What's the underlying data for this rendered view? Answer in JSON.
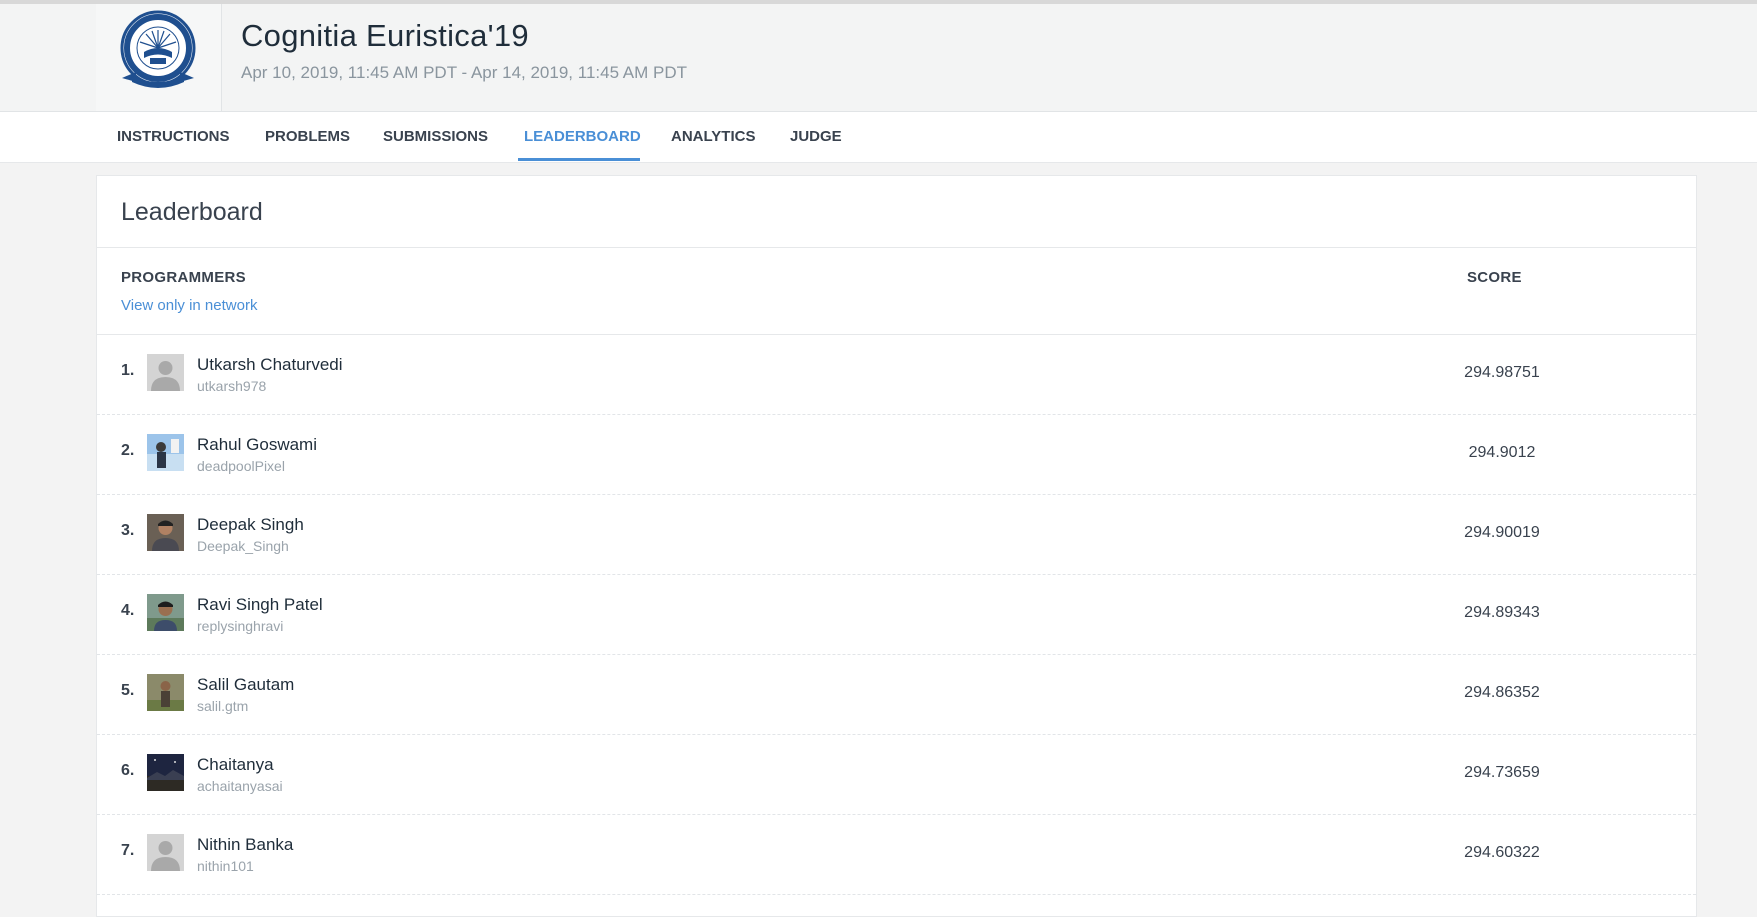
{
  "contest": {
    "title": "Cognitia Euristica'19",
    "dates": "Apr 10, 2019, 11:45 AM PDT - Apr 14, 2019, 11:45 AM PDT"
  },
  "tabs": [
    {
      "label": "INSTRUCTIONS",
      "active": false
    },
    {
      "label": "PROBLEMS",
      "active": false
    },
    {
      "label": "SUBMISSIONS",
      "active": false
    },
    {
      "label": "LEADERBOARD",
      "active": true
    },
    {
      "label": "ANALYTICS",
      "active": false
    },
    {
      "label": "JUDGE",
      "active": false
    }
  ],
  "leaderboard": {
    "title": "Leaderboard",
    "col_programmers": "PROGRAMMERS",
    "col_score": "SCORE",
    "network_link": "View only in network",
    "rows": [
      {
        "rank": "1.",
        "name": "Utkarsh Chaturvedi",
        "handle": "utkarsh978",
        "score": "294.98751",
        "avatar": "default"
      },
      {
        "rank": "2.",
        "name": "Rahul Goswami",
        "handle": "deadpoolPixel",
        "score": "294.9012",
        "avatar": "photo-sky"
      },
      {
        "rank": "3.",
        "name": "Deepak Singh",
        "handle": "Deepak_Singh",
        "score": "294.90019",
        "avatar": "photo-portrait"
      },
      {
        "rank": "4.",
        "name": "Ravi Singh Patel",
        "handle": "replysinghravi",
        "score": "294.89343",
        "avatar": "photo-outdoor"
      },
      {
        "rank": "5.",
        "name": "Salil Gautam",
        "handle": "salil.gtm",
        "score": "294.86352",
        "avatar": "photo-field"
      },
      {
        "rank": "6.",
        "name": "Chaitanya",
        "handle": "achaitanyasai",
        "score": "294.73659",
        "avatar": "photo-night"
      },
      {
        "rank": "7.",
        "name": "Nithin Banka",
        "handle": "nithin101",
        "score": "294.60322",
        "avatar": "default"
      }
    ]
  },
  "colors": {
    "accent": "#4a8fd6",
    "text": "#39424e",
    "muted": "#9aa3ab",
    "page_bg": "#f3f3f3"
  }
}
